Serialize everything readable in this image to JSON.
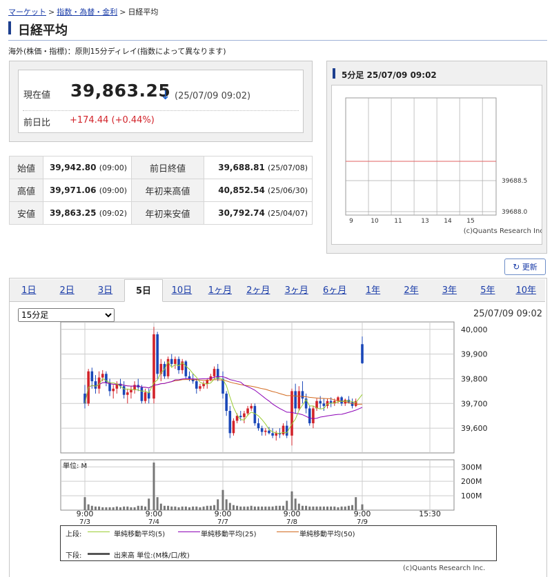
{
  "breadcrumb": {
    "items": [
      "マーケット",
      "指数・為替・金利"
    ],
    "current": "日経平均",
    "sep": ">"
  },
  "page_title": "日経平均",
  "note": "海外(株価・指標)：原則15分ディレイ(指数によって異なります)",
  "quote": {
    "current_label": "現在値",
    "price": "39,863.25",
    "arrow": "↓",
    "time": "(25/07/09 09:02)",
    "change_label": "前日比",
    "change": "+174.44 (+0.44%)"
  },
  "stats": [
    {
      "l1": "始値",
      "v1": "39,942.80",
      "t1": "(09:00)",
      "l2": "前日終値",
      "v2": "39,688.81",
      "t2": "(25/07/08)"
    },
    {
      "l1": "高値",
      "v1": "39,971.06",
      "t1": "(09:00)",
      "l2": "年初来高値",
      "v2": "40,852.54",
      "t2": "(25/06/30)"
    },
    {
      "l1": "安値",
      "v1": "39,863.25",
      "t1": "(09:02)",
      "l2": "年初来安値",
      "v2": "30,792.74",
      "t2": "(25/04/07)"
    }
  ],
  "mini_chart": {
    "title": "5分足 25/07/09 09:02",
    "x_ticks": [
      "9",
      "10",
      "11",
      "13",
      "14",
      "15"
    ],
    "y_ticks": [
      "39688.5",
      "39688.0"
    ],
    "credit": "(c)Quants Research Inc."
  },
  "refresh_label": "更新",
  "tabs": [
    "1日",
    "2日",
    "3日",
    "5日",
    "10日",
    "1ヶ月",
    "2ヶ月",
    "3ヶ月",
    "6ヶ月",
    "1年",
    "2年",
    "3年",
    "5年",
    "10年"
  ],
  "active_tab": "5日",
  "interval_select": {
    "selected": "15分足"
  },
  "chart_timestamp": "25/07/09 09:02",
  "chart_data": {
    "type": "candlestick",
    "price_ticks": [
      "40,000",
      "39,900",
      "39,800",
      "39,700",
      "39,600"
    ],
    "price_ylim": [
      39500,
      40030
    ],
    "volume_unit_label": "単位: M",
    "volume_ticks": [
      "300M",
      "200M",
      "100M"
    ],
    "x_tick_times": [
      "9:00",
      "9:00",
      "9:00",
      "9:00",
      "9:00",
      "15:30"
    ],
    "x_tick_dates": [
      "7/3",
      "7/4",
      "7/7",
      "7/8",
      "7/9",
      ""
    ],
    "days": [
      {
        "ohlc": [
          [
            39740,
            39775,
            39680,
            39700
          ],
          [
            39700,
            39840,
            39690,
            39830
          ],
          [
            39830,
            39845,
            39760,
            39790
          ],
          [
            39790,
            39815,
            39740,
            39760
          ],
          [
            39760,
            39830,
            39740,
            39805
          ],
          [
            39805,
            39835,
            39790,
            39820
          ],
          [
            39820,
            39830,
            39770,
            39785
          ],
          [
            39785,
            39800,
            39730,
            39750
          ],
          [
            39750,
            39775,
            39720,
            39760
          ],
          [
            39760,
            39790,
            39740,
            39780
          ],
          [
            39780,
            39800,
            39760,
            39770
          ],
          [
            39770,
            39790,
            39720,
            39735
          ],
          [
            39735,
            39760,
            39700,
            39745
          ],
          [
            39745,
            39770,
            39720,
            39755
          ],
          [
            39755,
            39790,
            39740,
            39775
          ],
          [
            39775,
            39800,
            39750,
            39765
          ],
          [
            39765,
            39775,
            39700,
            39710
          ],
          [
            39710,
            39760,
            39700,
            39745
          ],
          [
            39745,
            39760,
            39700,
            39720
          ]
        ],
        "vol": [
          90,
          40,
          30,
          25,
          25,
          20,
          20,
          20,
          20,
          25,
          20,
          25,
          25,
          20,
          20,
          30,
          30,
          25,
          80
        ]
      },
      {
        "ohlc": [
          [
            39720,
            40010,
            39700,
            39980
          ],
          [
            39980,
            39990,
            39800,
            39820
          ],
          [
            39820,
            39880,
            39790,
            39860
          ],
          [
            39860,
            39870,
            39800,
            39810
          ],
          [
            39810,
            39890,
            39800,
            39880
          ],
          [
            39880,
            39900,
            39850,
            39860
          ],
          [
            39860,
            39890,
            39840,
            39880
          ],
          [
            39880,
            39890,
            39820,
            39835
          ],
          [
            39835,
            39880,
            39820,
            39870
          ],
          [
            39870,
            39875,
            39800,
            39810
          ],
          [
            39810,
            39830,
            39790,
            39800
          ],
          [
            39800,
            39820,
            39780,
            39790
          ],
          [
            39790,
            39800,
            39740,
            39760
          ],
          [
            39760,
            39780,
            39750,
            39770
          ],
          [
            39770,
            39790,
            39760,
            39780
          ],
          [
            39780,
            39800,
            39760,
            39795
          ],
          [
            39795,
            39820,
            39790,
            39810
          ],
          [
            39810,
            39850,
            39800,
            39840
          ],
          [
            39840,
            39860,
            39790,
            39800
          ]
        ],
        "vol": [
          330,
          90,
          45,
          30,
          30,
          25,
          25,
          20,
          25,
          25,
          20,
          25,
          25,
          20,
          25,
          30,
          30,
          35,
          75
        ]
      },
      {
        "ohlc": [
          [
            39800,
            39830,
            39720,
            39740
          ],
          [
            39740,
            39750,
            39650,
            39670
          ],
          [
            39670,
            39690,
            39560,
            39580
          ],
          [
            39580,
            39640,
            39570,
            39630
          ],
          [
            39630,
            39660,
            39620,
            39650
          ],
          [
            39650,
            39670,
            39630,
            39645
          ],
          [
            39645,
            39670,
            39620,
            39660
          ],
          [
            39660,
            39690,
            39650,
            39680
          ],
          [
            39680,
            39700,
            39670,
            39690
          ],
          [
            39690,
            39700,
            39610,
            39620
          ],
          [
            39620,
            39640,
            39590,
            39600
          ],
          [
            39600,
            39610,
            39570,
            39585
          ],
          [
            39585,
            39600,
            39570,
            39590
          ],
          [
            39590,
            39605,
            39575,
            39580
          ],
          [
            39580,
            39600,
            39560,
            39570
          ],
          [
            39570,
            39590,
            39550,
            39580
          ],
          [
            39580,
            39600,
            39560,
            39575
          ],
          [
            39575,
            39620,
            39570,
            39610
          ],
          [
            39610,
            39630,
            39560,
            39570
          ]
        ],
        "vol": [
          140,
          75,
          50,
          35,
          30,
          25,
          25,
          25,
          30,
          25,
          25,
          25,
          25,
          25,
          25,
          30,
          30,
          30,
          65
        ]
      },
      {
        "ohlc": [
          [
            39570,
            39760,
            39530,
            39750
          ],
          [
            39750,
            39780,
            39660,
            39680
          ],
          [
            39680,
            39770,
            39670,
            39750
          ],
          [
            39750,
            39790,
            39700,
            39720
          ],
          [
            39720,
            39740,
            39660,
            39680
          ],
          [
            39680,
            39690,
            39610,
            39620
          ],
          [
            39620,
            39690,
            39600,
            39680
          ],
          [
            39680,
            39720,
            39670,
            39710
          ],
          [
            39710,
            39730,
            39680,
            39700
          ],
          [
            39700,
            39720,
            39670,
            39690
          ],
          [
            39690,
            39720,
            39680,
            39710
          ],
          [
            39710,
            39725,
            39685,
            39700
          ],
          [
            39700,
            39720,
            39690,
            39710
          ],
          [
            39710,
            39730,
            39700,
            39725
          ],
          [
            39725,
            39730,
            39690,
            39700
          ],
          [
            39700,
            39720,
            39690,
            39715
          ],
          [
            39715,
            39730,
            39700,
            39705
          ],
          [
            39705,
            39720,
            39680,
            39690
          ],
          [
            39690,
            39720,
            39685,
            39710
          ]
        ],
        "vol": [
          130,
          80,
          45,
          30,
          30,
          25,
          25,
          25,
          25,
          25,
          25,
          25,
          25,
          20,
          25,
          25,
          30,
          35,
          90
        ]
      },
      {
        "ohlc": [
          [
            39940,
            39971,
            39860,
            39863
          ]
        ],
        "vol": [
          40
        ]
      }
    ],
    "sma_colors": {
      "sma5": "#9acd32",
      "sma25": "#8b00b6",
      "sma50": "#d2691e"
    }
  },
  "legend": {
    "upper_label": "上段:",
    "sma5": "単純移動平均(5)",
    "sma25": "単純移動平均(25)",
    "sma50": "単純移動平均(50)",
    "lower_label": "下段:",
    "volume": "出来高 単位:(M株/口/枚)"
  },
  "credit": "(c)Quants Research Inc."
}
